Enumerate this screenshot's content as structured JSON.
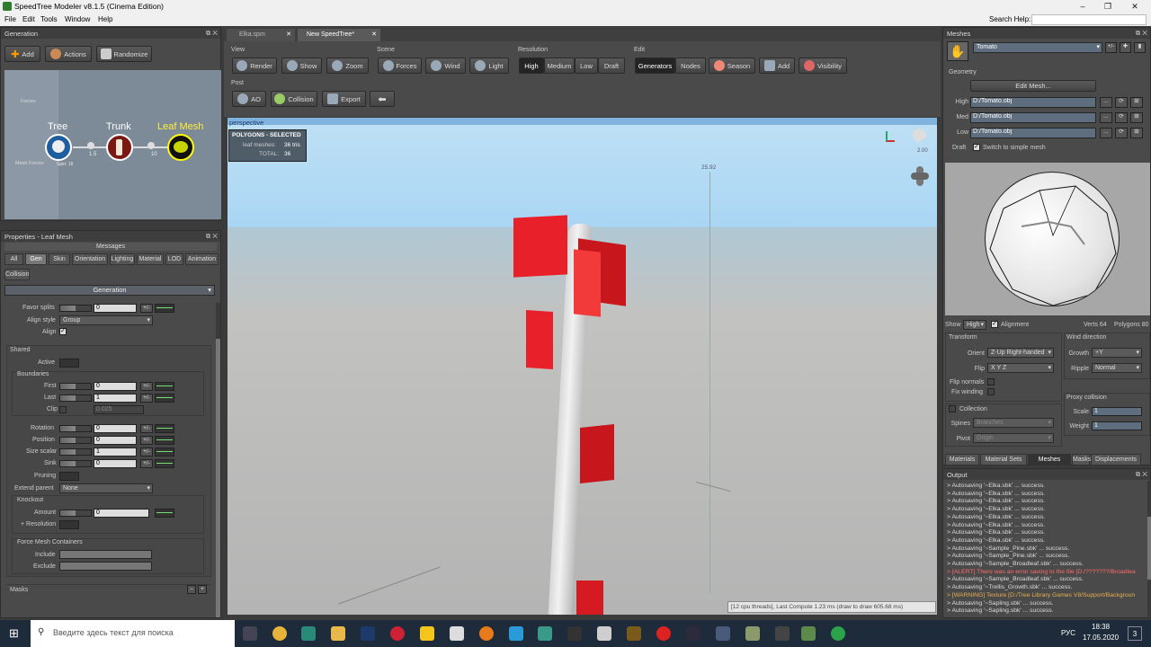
{
  "window": {
    "title": "SpeedTree Modeler v8.1.5 (Cinema Edition)"
  },
  "menu": [
    "File",
    "Edit",
    "Tools",
    "Window",
    "Help"
  ],
  "search": {
    "label": "Search Help:"
  },
  "generation": {
    "title": "Generation",
    "buttons": [
      "Add",
      "Actions",
      "Randomize"
    ],
    "graph": {
      "side_labels": [
        "Forces",
        "Mesh Forces"
      ],
      "nodes": [
        "Tree",
        "Trunk",
        "Leaf Mesh"
      ],
      "node_sub": "Spin: 16",
      "links": [
        "1.5",
        "10"
      ]
    }
  },
  "doc_tabs": [
    "Elka.spm",
    "New SpeedTree*"
  ],
  "toolbar": {
    "view": {
      "label": "View",
      "buttons": [
        "Render",
        "Show",
        "Zoom"
      ]
    },
    "scene": {
      "label": "Scene",
      "buttons": [
        "Forces",
        "Wind",
        "Light"
      ]
    },
    "resolution": {
      "label": "Resolution",
      "buttons": [
        "High",
        "Medium",
        "Low",
        "Draft"
      ],
      "selected": "High"
    },
    "edit": {
      "label": "Edit",
      "buttons": [
        "Generators",
        "Nodes",
        "Season",
        "Add",
        "Visibility"
      ],
      "selected": "Generators"
    },
    "post": {
      "label": "Post",
      "buttons": [
        "AO",
        "Collision",
        "Export"
      ]
    }
  },
  "viewport": {
    "label": "perspective",
    "stats": {
      "title": "POLYGONS - SELECTED",
      "row1_label": "leaf meshes:",
      "row1_value": "36 tris",
      "row2_label": "TOTAL:",
      "row2_value": "36"
    },
    "height_marker": "25.92",
    "light_value": "2.00",
    "status": "[12 cpu threads], Last Compute 1.23 ms (draw to draw 605.68 ms)"
  },
  "properties": {
    "title": "Properties - Leaf Mesh",
    "messages": "Messages",
    "tabs": [
      "All",
      "Gen",
      "Skin",
      "Orientation",
      "Lighting",
      "Material",
      "LOD",
      "Animation",
      "Collision"
    ],
    "selected_tab": "Gen",
    "section": "Generation",
    "favor_splits": {
      "label": "Favor splits",
      "value": "0"
    },
    "align_style": {
      "label": "Align style",
      "value": "Group"
    },
    "align": {
      "label": "Align",
      "checked": true
    },
    "shared": "Shared",
    "active": "Active",
    "boundaries": {
      "label": "Boundaries",
      "first": {
        "label": "First",
        "value": "0"
      },
      "last": {
        "label": "Last",
        "value": "1"
      },
      "clip": {
        "label": "Clip",
        "value": "0.025"
      }
    },
    "rotation": {
      "label": "Rotation",
      "value": "0"
    },
    "position": {
      "label": "Position",
      "value": "0"
    },
    "size_scalar": {
      "label": "Size scalar",
      "value": "1"
    },
    "sink": {
      "label": "Sink",
      "value": "0"
    },
    "pruning": "Pruning",
    "extend_parent": {
      "label": "Extend parent",
      "value": "None"
    },
    "knockout": {
      "label": "Knockout",
      "amount_label": "Amount",
      "amount_value": "0",
      "resolution": "+ Resolution"
    },
    "force_mesh": {
      "label": "Force Mesh Containers",
      "include": "Include",
      "exclude": "Exclude"
    },
    "masks": "Masks",
    "pm": "+/-"
  },
  "meshes": {
    "title": "Meshes",
    "mesh_name": "Tomato",
    "geometry": "Geometry",
    "edit_mesh": "Edit Mesh...",
    "lods": [
      {
        "label": "High",
        "path": "D:/Tomato.obj"
      },
      {
        "label": "Med",
        "path": "D:/Tomato.obj"
      },
      {
        "label": "Low",
        "path": "D:/Tomato.obj"
      }
    ],
    "draft": {
      "label": "Draft",
      "checkbox": "Switch to simple mesh"
    },
    "show": {
      "label": "Show",
      "value": "High",
      "alignment": "Alignment"
    },
    "verts": "Verts 64",
    "polygons": "Polygons 80",
    "transform": {
      "label": "Transform",
      "orient_label": "Orient",
      "orient_value": "Z-Up Right-handed",
      "flip_label": "Flip",
      "flip_value": "X Y Z",
      "flip_normals": "Flip normals",
      "fix_winding": "Fix winding"
    },
    "wind": {
      "label": "Wind direction",
      "growth_label": "Growth",
      "growth_value": "+Y",
      "ripple_label": "Ripple",
      "ripple_value": "Normal"
    },
    "collection": {
      "label": "Collection",
      "spines_label": "Spines",
      "spines_value": "Branches",
      "pivot_label": "Pivot",
      "pivot_value": "Origin"
    },
    "proxy": {
      "label": "Proxy collision",
      "scale_label": "Scale",
      "scale_value": "1",
      "weight_label": "Weight",
      "weight_value": "1"
    },
    "tabs": [
      "Materials",
      "Material Sets",
      "Meshes",
      "Masks",
      "Displacements"
    ],
    "selected_tab": "Meshes"
  },
  "output": {
    "title": "Output",
    "lines": [
      {
        "t": "> Autosaving '~Elka.sbk' ... success.",
        "c": "#dddddd"
      },
      {
        "t": "> Autosaving '~Elka.sbk' ... success.",
        "c": "#dddddd"
      },
      {
        "t": "> Autosaving '~Elka.sbk' ... success.",
        "c": "#dddddd"
      },
      {
        "t": "> Autosaving '~Elka.sbk' ... success.",
        "c": "#dddddd"
      },
      {
        "t": "> Autosaving '~Elka.sbk' ... success.",
        "c": "#dddddd"
      },
      {
        "t": "> Autosaving '~Elka.sbk' ... success.",
        "c": "#dddddd"
      },
      {
        "t": "> Autosaving '~Elka.sbk' ... success.",
        "c": "#dddddd"
      },
      {
        "t": "> Autosaving '~Elka.sbk' ... success.",
        "c": "#dddddd"
      },
      {
        "t": "> Autosaving '~Sample_Pine.sbk' ... success.",
        "c": "#dddddd"
      },
      {
        "t": "> Autosaving '~Sample_Pine.sbk' ... success.",
        "c": "#dddddd"
      },
      {
        "t": "> Autosaving '~Sample_Broadleaf.sbk' ... success.",
        "c": "#dddddd"
      },
      {
        "t": "> [ALERT] There was an error saving to the file [D:/???????/Broadlea",
        "c": "#ff6a6a"
      },
      {
        "t": "> Autosaving '~Sample_Broadleaf.sbk' ... success.",
        "c": "#dddddd"
      },
      {
        "t": "> Autosaving '~Trellis_Growth.sbk' ... success.",
        "c": "#dddddd"
      },
      {
        "t": "> [WARNING] Texture [D:/Tree Library Games V8/Support/Backgroun",
        "c": "#e6b050"
      },
      {
        "t": "> Autosaving '~Sapling.sbk' ... success.",
        "c": "#dddddd"
      },
      {
        "t": "> Autosaving '~Sapling.sbk' ... success.",
        "c": "#dddddd"
      }
    ]
  },
  "taskbar": {
    "search_placeholder": "Введите здесь текст для поиска",
    "lang": "РУС",
    "time": "18:38",
    "date": "17.05.2020",
    "notif": "3"
  },
  "colors": {
    "accent": "#e8202a",
    "sky": "#a9d6f4",
    "panel": "#4a4a4a"
  }
}
